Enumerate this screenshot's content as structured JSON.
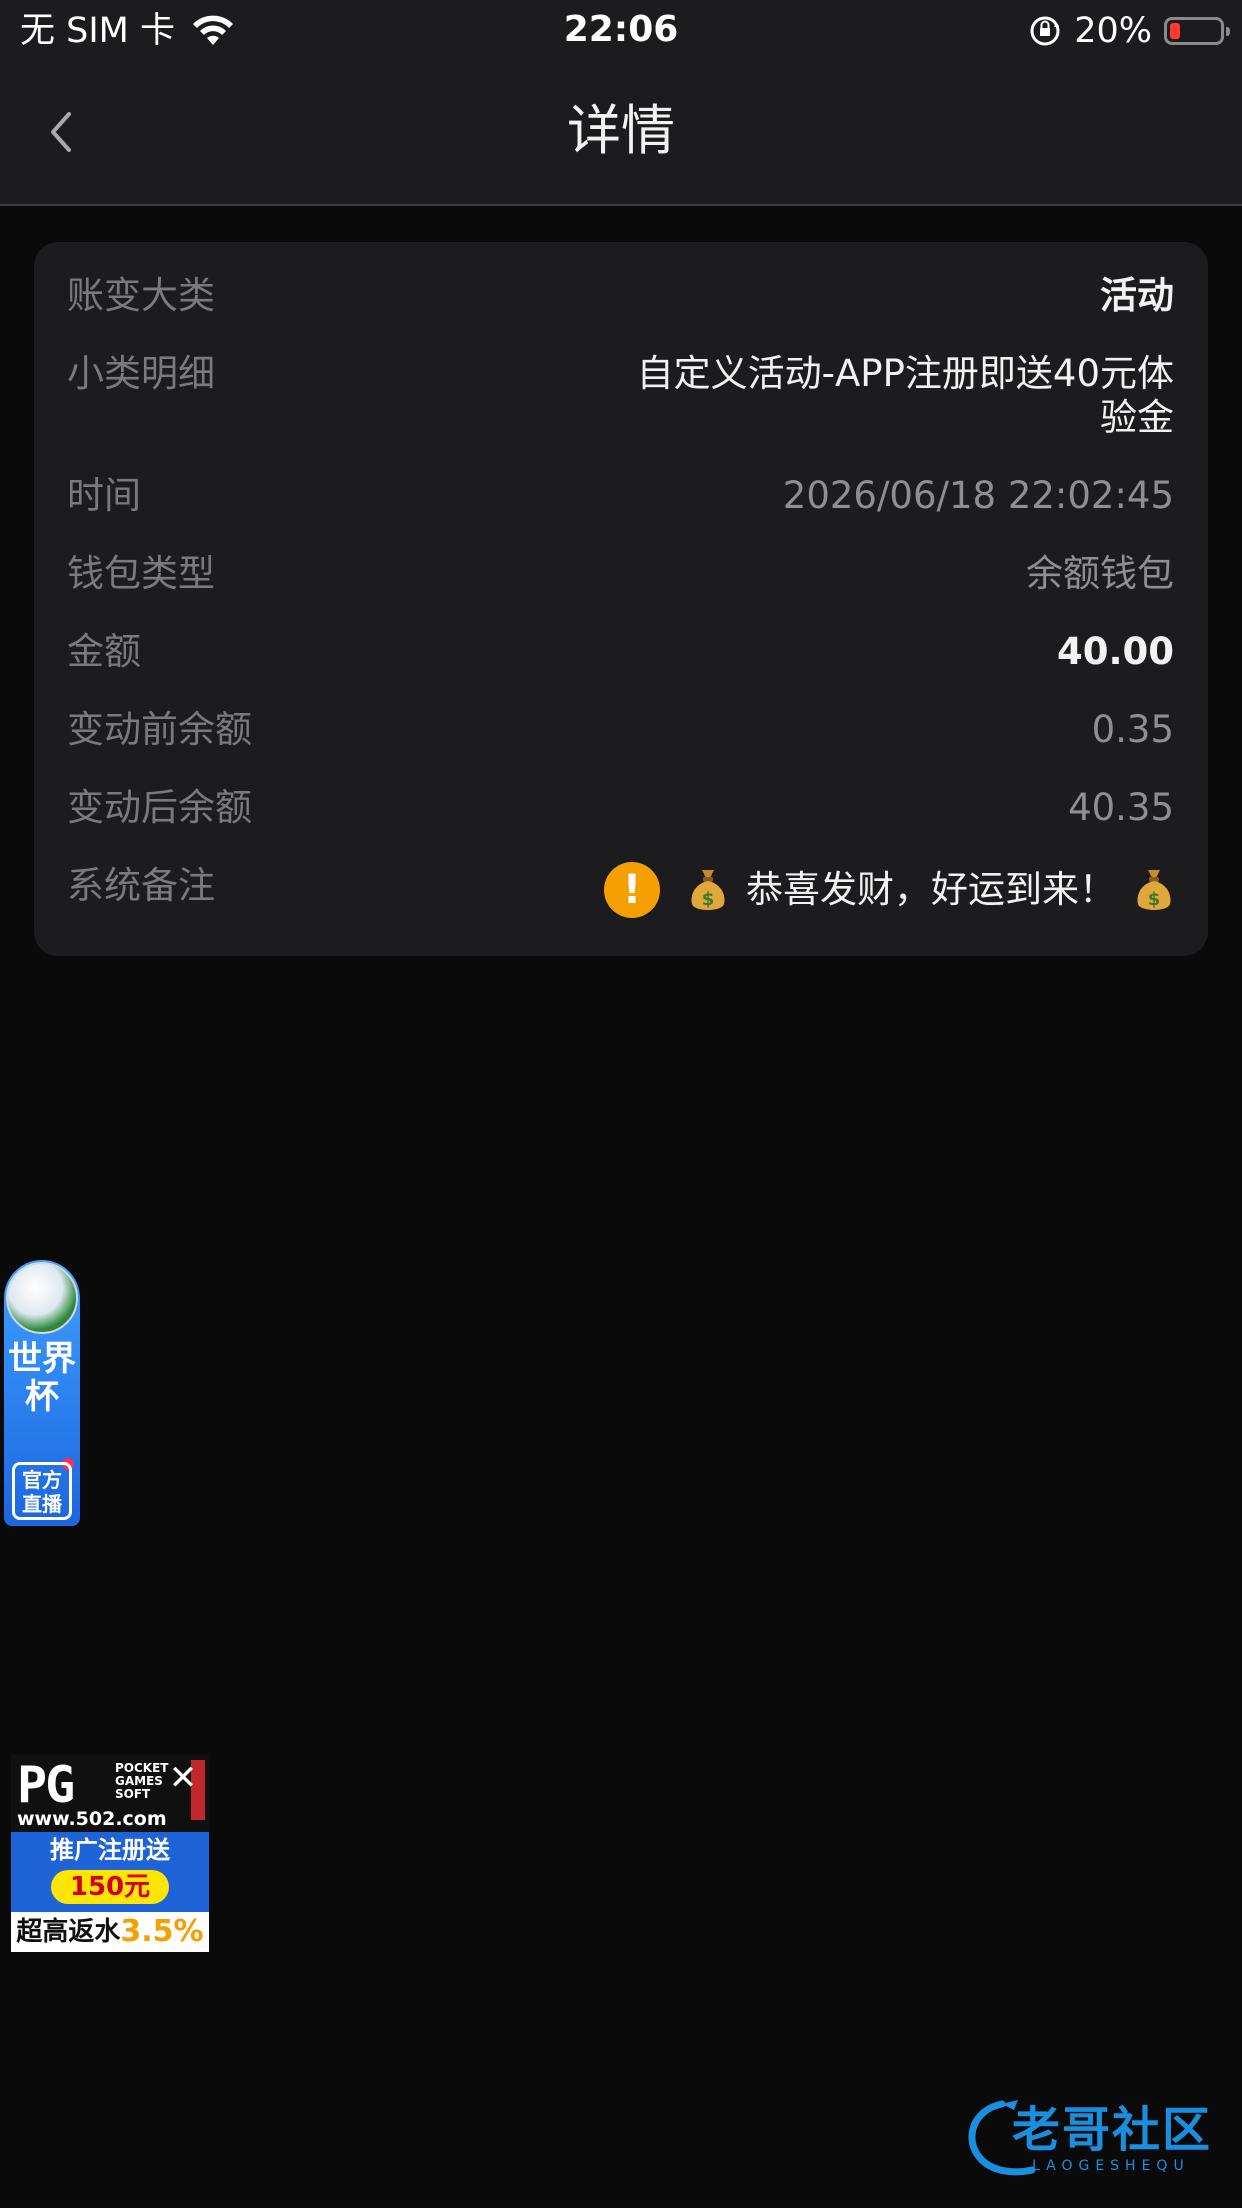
{
  "status_bar": {
    "carrier": "无 SIM 卡",
    "time": "22:06",
    "battery": "20%",
    "battery_level": 0.2,
    "battery_color": "#ff3b30"
  },
  "nav": {
    "title": "详情",
    "back_icon": "chevron-left-icon"
  },
  "details": {
    "category_label": "账变大类",
    "category_value": "活动",
    "subcategory_label": "小类明细",
    "subcategory_value": "自定义活动-APP注册即送40元体验金",
    "time_label": "时间",
    "time_value": "2026/06/18 22:02:45",
    "wallet_label": "钱包类型",
    "wallet_value": "余额钱包",
    "amount_label": "金额",
    "amount_value": "40.00",
    "before_label": "变动前余额",
    "before_value": "0.35",
    "after_label": "变动后余额",
    "after_value": "40.35",
    "remark_label": "系统备注",
    "remark_value": "恭喜发财，好运到来！",
    "remark_icons": [
      "warning-icon",
      "money-bag-icon"
    ]
  },
  "ads": {
    "worldcup_title": "世界杯",
    "worldcup_badge": "官方直播",
    "pg_logo": "PG",
    "pg_pocket": "POCKET GAMES SOFT",
    "pg_url": "www.502.com",
    "pg_promo": "推广注册送",
    "pg_amount": "150元",
    "pg_rebate_label": "超高返水",
    "pg_rebate_value": "3.5%"
  },
  "watermark": {
    "text": "老哥社区",
    "sub": "LAOGESHEQU"
  },
  "colors": {
    "background": "#0a0a0a",
    "card": "#1c1c1e",
    "label": "#7a7a7e",
    "value": "#8e8e93",
    "accent_warning": "#f5a000"
  }
}
